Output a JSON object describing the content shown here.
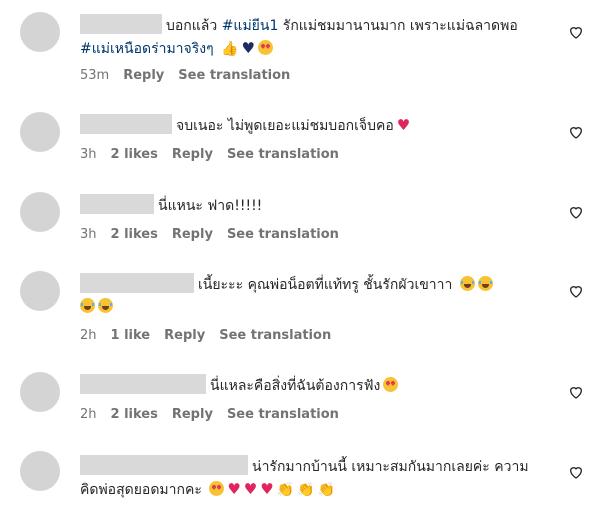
{
  "comments": [
    {
      "text_parts": [
        "บอกแล้ว ",
        "#แม่ยีน1",
        " รักแม่ชมมานานมาก เพราะแม่ฉลาดพอ ",
        "#แม่เหนือดร่ามาจริงๆ"
      ],
      "emojis": [
        "thumbs-up",
        "navy-heart",
        "heart-eyes"
      ],
      "time": "53m",
      "likes": "",
      "reply": "Reply",
      "see_translation": "See translation"
    },
    {
      "text": "จบเนอะ ไม่พูดเยอะแม่ชมบอกเจ็บคอ",
      "emojis": [
        "red-heart"
      ],
      "time": "3h",
      "likes": "2 likes",
      "reply": "Reply",
      "see_translation": "See translation"
    },
    {
      "text": "นี่แหนะ ฟาด!!!!!",
      "emojis": [],
      "time": "3h",
      "likes": "2 likes",
      "reply": "Reply",
      "see_translation": "See translation"
    },
    {
      "text": "เนี้ยะะะ คุณพ่อน็อตที่แท้ทรู ชั้นรักผัวเขาาา",
      "emojis": [
        "laughing-tears",
        "laughing-tears",
        "laughing-tears",
        "laughing-tears"
      ],
      "time": "2h",
      "likes": "1 like",
      "reply": "Reply",
      "see_translation": "See translation"
    },
    {
      "text": "นี่แหละคือสิ่งที่ฉันต้องการฟัง",
      "emojis": [
        "heart-eyes"
      ],
      "time": "2h",
      "likes": "2 likes",
      "reply": "Reply",
      "see_translation": "See translation"
    },
    {
      "text": "น่ารักมากบ้านนี้ เหมาะสมกันมากเลยค่ะ ความคิดพ่อสุดยอดมากคะ",
      "emojis": [
        "heart-eyes",
        "red-heart",
        "red-heart",
        "red-heart",
        "clap",
        "clap",
        "clap"
      ],
      "time": "",
      "likes": "",
      "reply": "",
      "see_translation": ""
    }
  ],
  "colors": {
    "hashtag": "#00376b",
    "meta": "#737373",
    "heart": "#e0245e"
  }
}
